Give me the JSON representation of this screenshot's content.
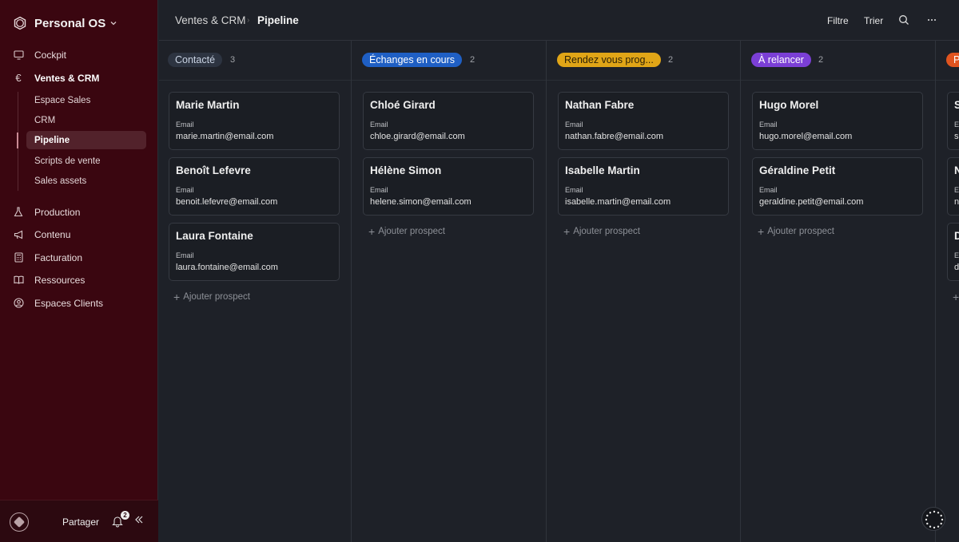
{
  "workspace": {
    "name": "Personal OS"
  },
  "sidebar": {
    "items": [
      {
        "label": "Cockpit",
        "icon": "monitor-icon"
      },
      {
        "label": "Ventes & CRM",
        "icon": "euro-icon"
      },
      {
        "label": "Production",
        "icon": "flask-icon"
      },
      {
        "label": "Contenu",
        "icon": "megaphone-icon"
      },
      {
        "label": "Facturation",
        "icon": "calculator-icon"
      },
      {
        "label": "Ressources",
        "icon": "book-icon"
      },
      {
        "label": "Espaces Clients",
        "icon": "user-circle-icon"
      }
    ],
    "subitems": [
      {
        "label": "Espace Sales"
      },
      {
        "label": "CRM"
      },
      {
        "label": "Pipeline"
      },
      {
        "label": "Scripts de vente"
      },
      {
        "label": "Sales assets"
      }
    ],
    "footer": {
      "share": "Partager",
      "notifications": "2"
    }
  },
  "header": {
    "crumb_parent": "Ventes & CRM",
    "crumb_current": "Pipeline",
    "filter": "Filtre",
    "sort": "Trier"
  },
  "board": {
    "email_label": "Email",
    "add_label": "Ajouter prospect",
    "columns": [
      {
        "title": "Contacté",
        "count": "3",
        "pill_bg": "#2d3441",
        "pill_fg": "#c9d3e3",
        "cards": [
          {
            "name": "Marie Martin",
            "email": "marie.martin@email.com"
          },
          {
            "name": "Benoît Lefevre",
            "email": "benoit.lefevre@email.com"
          },
          {
            "name": "Laura Fontaine",
            "email": "laura.fontaine@email.com"
          }
        ]
      },
      {
        "title": "Échanges en cours",
        "count": "2",
        "pill_bg": "#1f5fc4",
        "pill_fg": "#ffffff",
        "cards": [
          {
            "name": "Chloé Girard",
            "email": "chloe.girard@email.com"
          },
          {
            "name": "Hélène Simon",
            "email": "helene.simon@email.com"
          }
        ]
      },
      {
        "title": "Rendez vous prog...",
        "count": "2",
        "pill_bg": "#e0a517",
        "pill_fg": "#2a1f05",
        "cards": [
          {
            "name": "Nathan Fabre",
            "email": "nathan.fabre@email.com"
          },
          {
            "name": "Isabelle Martin",
            "email": "isabelle.martin@email.com"
          }
        ]
      },
      {
        "title": "À relancer",
        "count": "2",
        "pill_bg": "#7b3fd6",
        "pill_fg": "#ffffff",
        "cards": [
          {
            "name": "Hugo Morel",
            "email": "hugo.morel@email.com"
          },
          {
            "name": "Géraldine Petit",
            "email": "geraldine.petit@email.com"
          }
        ]
      },
      {
        "title": "P",
        "count": "",
        "pill_bg": "#e0541f",
        "pill_fg": "#ffffff",
        "cards": [
          {
            "name": "S",
            "email": "s"
          },
          {
            "name": "N",
            "email": "n"
          },
          {
            "name": "D",
            "email": "d"
          }
        ]
      }
    ]
  }
}
